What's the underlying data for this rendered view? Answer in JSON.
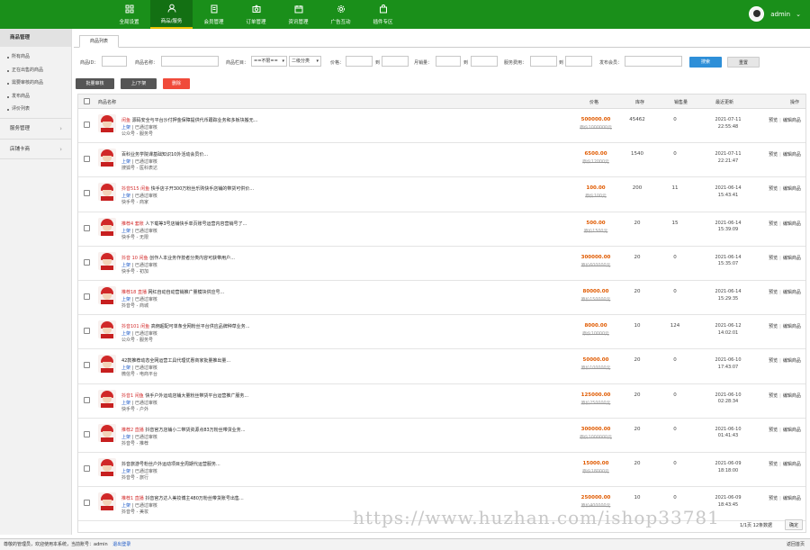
{
  "nav": [
    {
      "label": "全局设置",
      "icon": "grid-icon",
      "active": false
    },
    {
      "label": "商品/服务",
      "icon": "user-icon",
      "active": true
    },
    {
      "label": "会员管理",
      "icon": "member-icon",
      "active": false
    },
    {
      "label": "订单管理",
      "icon": "camera-icon",
      "active": false
    },
    {
      "label": "资讯管理",
      "icon": "calendar-icon",
      "active": false
    },
    {
      "label": "广告互动",
      "icon": "gear-icon",
      "active": false
    },
    {
      "label": "插件专区",
      "icon": "bag-icon",
      "active": false
    }
  ],
  "user": {
    "name": "admin"
  },
  "sidebar": {
    "header": "商品管理",
    "items": [
      "所有商品",
      "正在出售的商品",
      "需要审核的商品",
      "发布商品",
      "评价列表"
    ],
    "groups": [
      "服务管理",
      "店铺卡商"
    ]
  },
  "tab": "商品列表",
  "filters": {
    "id_label": "商品ID：",
    "name_label": "商品名称：",
    "category_label": "商品栏目：",
    "category_value": "==不限==",
    "category2_value": "二级分类",
    "price_label": "价格：",
    "to": "到",
    "sales_label": "月销量：",
    "amount_label": "服务费用：",
    "member_label": "发布会员：",
    "search": "搜索",
    "reset": "重置"
  },
  "actions": {
    "batch": "批量审核",
    "toggle": "上/下架",
    "delete": "删除"
  },
  "columns": {
    "name": "商品名称",
    "price": "价格",
    "stock": "库存",
    "sales": "销售量",
    "updated": "最近更新",
    "ops": "操作"
  },
  "rows": [
    {
      "tag": "闲鱼",
      "title": "源码安全与平台沙付押金保障提供代币跟踪业务和多板块搬无...",
      "status": "上架",
      "audit": "已通过审核",
      "seller": "公众号 - 服务号",
      "price": "500000.00",
      "orig": "原价1000000元",
      "stock": "45462",
      "sales": "0",
      "date": "2021-07-11",
      "time": "22:55:48"
    },
    {
      "tag": "",
      "title": "百科业务学院课基础知识10外活动会员价...",
      "status": "上架",
      "audit": "已通过审核",
      "seller": "搜狐号 - 医科表达",
      "price": "6500.00",
      "orig": "原价12000元",
      "stock": "1540",
      "sales": "0",
      "date": "2021-07-11",
      "time": "22:21:47"
    },
    {
      "tag": "抖音515 闲鱼",
      "title": "快手店子开300万粉丝乐购快手店铺的带货可供价...",
      "status": "上架",
      "audit": "已通过审核",
      "seller": "快手号 - 商家",
      "price": "100.00",
      "orig": "原价100元",
      "stock": "200",
      "sales": "11",
      "date": "2021-06-14",
      "time": "15:43:41"
    },
    {
      "tag": "推荐4 套账",
      "title": "人下载等3号店铺快手单页账号运营内容营销号了...",
      "status": "上架",
      "audit": "已通过审核",
      "seller": "快手号 - 无限",
      "price": "500.00",
      "orig": "原价1500元",
      "stock": "20",
      "sales": "15",
      "date": "2021-06-14",
      "time": "15:39:09"
    },
    {
      "tag": "抖音 10 闲鱼",
      "title": "创作人本业务作技者分类内容可获带用户...",
      "status": "上架",
      "audit": "已通过审核",
      "seller": "快手号 - 初加",
      "price": "300000.00",
      "orig": "原价600000元",
      "stock": "20",
      "sales": "0",
      "date": "2021-06-14",
      "time": "15:35:07"
    },
    {
      "tag": "推荐18 直播",
      "title": "网红自动自动营销推广量模块供应号...",
      "status": "上架",
      "audit": "已通过审核",
      "seller": "抖音号 - 商城",
      "price": "80000.00",
      "orig": "原价150000元",
      "stock": "20",
      "sales": "0",
      "date": "2021-06-14",
      "time": "15:29:35"
    },
    {
      "tag": "抖音101 闲鱼",
      "title": "高佣超配可单条全网粉丝平台供应品牌种草业务...",
      "status": "上架",
      "audit": "已通过审核",
      "seller": "公众号 - 服务号",
      "price": "8000.00",
      "orig": "原价10000元",
      "stock": "10",
      "sales": "124",
      "date": "2021-06-12",
      "time": "14:02:01"
    },
    {
      "tag": "",
      "title": "42款推荐动态全网运营工具代理优惠商家批量推出量...",
      "status": "上架",
      "audit": "已通过审核",
      "seller": "微信号 - 电商平台",
      "price": "50000.00",
      "orig": "原价100000元",
      "stock": "20",
      "sales": "0",
      "date": "2021-06-10",
      "time": "17:43:07"
    },
    {
      "tag": "抖音1 闲鱼",
      "title": "快手户外运动店铺大量粉丝带货平台运营推广服务...",
      "status": "上架",
      "audit": "已通过审核",
      "seller": "快手号 - 户外",
      "price": "125000.00",
      "orig": "原价250000元",
      "stock": "20",
      "sales": "0",
      "date": "2021-06-10",
      "time": "02:28:34"
    },
    {
      "tag": "推荐2 直播",
      "title": "抖音官方店铺小二带货资源点83万粉丝带货业务...",
      "status": "上架",
      "audit": "已通过审核",
      "seller": "抖音号 - 推荐",
      "price": "300000.00",
      "orig": "原价1000000元",
      "stock": "20",
      "sales": "0",
      "date": "2021-06-10",
      "time": "01:41:43"
    },
    {
      "tag": "",
      "title": "抖音旅游号粉丝户外运动项目全周期代运营服务...",
      "status": "上架",
      "audit": "已通过审核",
      "seller": "抖音号 - 旅行",
      "price": "15000.00",
      "orig": "原价18000元",
      "stock": "20",
      "sales": "0",
      "date": "2021-06-09",
      "time": "18:18:00"
    },
    {
      "tag": "推荐1 直播",
      "title": "抖音官方达人美妆博主480万粉丝带货账号出售...",
      "status": "上架",
      "audit": "已通过审核",
      "seller": "抖音号 - 美妆",
      "price": "250000.00",
      "orig": "原价400000元",
      "stock": "10",
      "sales": "0",
      "date": "2021-06-09",
      "time": "18:43:45"
    }
  ],
  "pager": {
    "text": "1/1页 12条数据",
    "go": "确定"
  },
  "footer": {
    "text": "尊敬的管理员，欢迎使用本系统，当前账号：admin",
    "link": "退出登录",
    "help": "返回首页"
  },
  "watermark": "https://www.huzhan.com/ishop33781"
}
